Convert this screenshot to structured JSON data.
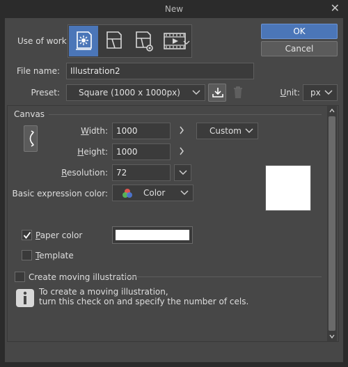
{
  "window": {
    "title": "New"
  },
  "use_of_work": {
    "label": "Use of work:",
    "items": [
      {
        "name": "illustration",
        "icon": "illustration-icon",
        "selected": true
      },
      {
        "name": "comic",
        "icon": "comic-icon",
        "selected": false
      },
      {
        "name": "show-all-comic-settings",
        "icon": "comic-settings-icon",
        "selected": false
      },
      {
        "name": "animation",
        "icon": "animation-icon",
        "selected": false
      }
    ]
  },
  "file_name": {
    "label": "File name:",
    "value": "Illustration2"
  },
  "preset": {
    "label": "Preset:",
    "value": "Square (1000 x 1000px)"
  },
  "unit": {
    "label": "Unit:",
    "value": "px"
  },
  "buttons": {
    "ok": "OK",
    "cancel": "Cancel"
  },
  "canvas": {
    "section_label": "Canvas",
    "width": {
      "label": "Width:",
      "value": "1000"
    },
    "height": {
      "label": "Height:",
      "value": "1000"
    },
    "resolution": {
      "label": "Resolution:",
      "value": "72"
    },
    "size_preset": "Custom",
    "expression_color": {
      "label": "Basic expression color:",
      "value": "Color"
    }
  },
  "paper_color": {
    "label": "Paper color",
    "checked": true,
    "color": "#ffffff"
  },
  "template": {
    "label": "Template",
    "checked": false
  },
  "moving": {
    "label": "Create moving illustration",
    "checked": false,
    "info_line1": "To create a moving illustration,",
    "info_line2": "turn this check on and specify the number of cels."
  },
  "colors": {
    "accent": "#4b76b8",
    "panel": "#474747",
    "field": "#3b3b3b"
  }
}
